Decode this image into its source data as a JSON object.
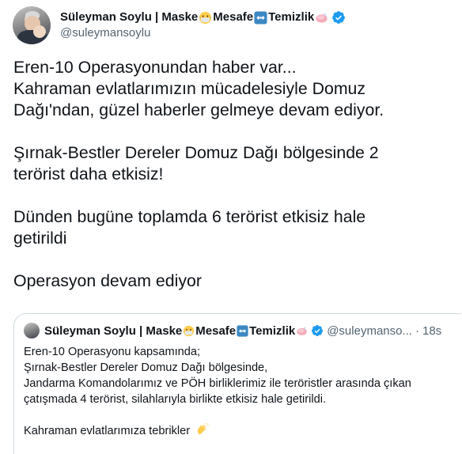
{
  "author": {
    "name_parts": [
      "Süleyman Soylu | Maske",
      "Mesafe",
      "Temizlik"
    ],
    "handle": "@suleymansoylu",
    "emojis": [
      "mask-face-emoji",
      "left-right-arrow-emoji",
      "soap-emoji"
    ],
    "verified_color": "#1d9bf0"
  },
  "tweet": {
    "paragraphs": [
      [
        "Eren-10 Operasyonundan haber var...",
        "Kahraman evlatlarımızın mücadelesiyle Domuz",
        "Dağı'ndan, güzel haberler gelmeye devam ediyor."
      ],
      [
        "Şırnak-Bestler Dereler Domuz Dağı bölgesinde 2",
        "terörist daha etkisiz!"
      ],
      [
        "Dünden bugüne toplamda 6 terörist etkisiz hale",
        "getirildi"
      ],
      [
        "Operasyon devam ediyor"
      ]
    ]
  },
  "quoted": {
    "name_parts": [
      "Süleyman Soylu | Maske",
      "Mesafe",
      "Temizlik"
    ],
    "handle": "@suleymanso...",
    "time": "18s",
    "lines": [
      "Eren-10 Operasyonu kapsamında;",
      "Şırnak-Bestler Dereler Domuz Dağı bölgesinde,",
      "Jandarma Komandolarımız ve PÖH birliklerimiz ile teröristler arasında çıkan",
      "çatışmada 4 terörist, silahlarıyla birlikte etkisiz hale getirildi."
    ],
    "closing": "Kahraman evlatlarımıza tebrikler",
    "closing_emoji": "clapping-hands-emoji"
  },
  "colors": {
    "text": "#0f1419",
    "secondary": "#536471",
    "border": "#cfd9de",
    "accent": "#1d9bf0"
  }
}
